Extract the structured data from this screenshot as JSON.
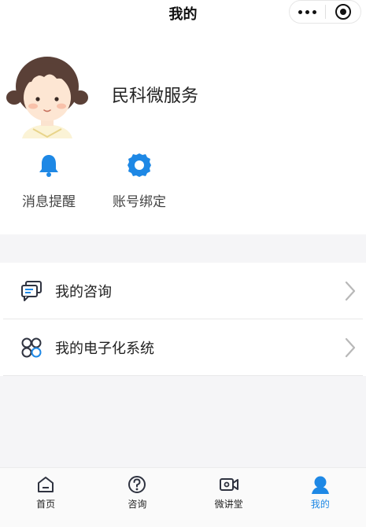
{
  "navbar": {
    "title": "我的"
  },
  "profile": {
    "name": "民科微服务"
  },
  "quick_actions": [
    {
      "label": "消息提醒",
      "icon": "bell-icon"
    },
    {
      "label": "账号绑定",
      "icon": "gear-icon"
    }
  ],
  "menu": [
    {
      "label": "我的咨询",
      "icon": "chat-icon"
    },
    {
      "label": "我的电子化系统",
      "icon": "grid-icon"
    }
  ],
  "tabs": [
    {
      "label": "首页",
      "icon": "home-icon"
    },
    {
      "label": "咨询",
      "icon": "question-icon"
    },
    {
      "label": "微讲堂",
      "icon": "video-icon"
    },
    {
      "label": "我的",
      "icon": "user-icon",
      "active": true
    }
  ],
  "colors": {
    "accent": "#1e88e5",
    "icon_dark": "#2f3340"
  }
}
